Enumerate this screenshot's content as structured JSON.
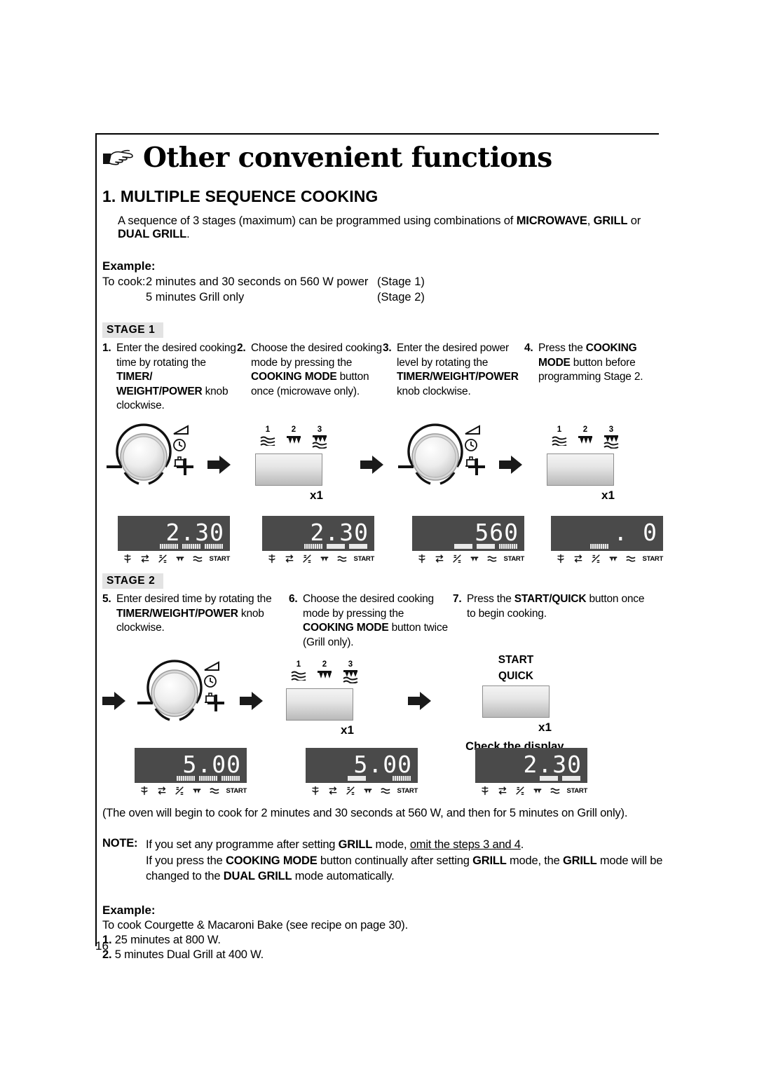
{
  "header": {
    "icon": "pointing-hand-icon",
    "title": "Other convenient functions"
  },
  "section": {
    "title": "1. MULTIPLE SEQUENCE COOKING",
    "intro_pre": "A sequence of 3 stages (maximum) can be programmed using combinations of ",
    "intro_b1": "MICROWAVE",
    "intro_mid1": ", ",
    "intro_b2": "GRILL",
    "intro_mid2": " or ",
    "intro_b3": "DUAL GRILL",
    "intro_end": "."
  },
  "example1": {
    "label": "Example:",
    "line1_c1": "To cook:",
    "line1_c2": "2 minutes and 30 seconds on 560 W power",
    "line1_c3": "(Stage 1)",
    "line2_c2": "5 minutes Grill only",
    "line2_c3": "(Stage 2)"
  },
  "stage1": {
    "band": "STAGE  1",
    "steps": [
      {
        "num": "1.",
        "pre": "Enter the desired cooking time by rotating the ",
        "b1": "TIMER/ WEIGHT/POWER",
        "post": " knob clockwise."
      },
      {
        "num": "2.",
        "pre": "Choose the desired cooking mode by pressing the ",
        "b1": "COOKING MODE",
        "post": " button once (microwave only)."
      },
      {
        "num": "3.",
        "pre": "Enter the desired power level by rotating the ",
        "b1": "TIMER/WEIGHT/POWER",
        "post": " knob clockwise."
      },
      {
        "num": "4.",
        "pre": "Press the ",
        "b1": "COOKING MODE",
        "post": " button before programming Stage 2."
      }
    ],
    "displays": [
      {
        "value": "2.30",
        "bars": [
          "hatch",
          "hatch",
          "hatch"
        ]
      },
      {
        "value": "2.30",
        "bars": [
          "hatch",
          "on",
          "on"
        ]
      },
      {
        "value": "560",
        "bars": [
          "on",
          "on",
          "hatch"
        ]
      },
      {
        "value": ".    0",
        "bars": [
          "hatch"
        ]
      }
    ],
    "press_count": "x1"
  },
  "stage2": {
    "band": "STAGE  2",
    "steps": [
      {
        "num": "5.",
        "pre": "Enter desired time by rotating the ",
        "b1": "TIMER/WEIGHT/POWER",
        "post": " knob clockwise."
      },
      {
        "num": "6.",
        "pre": "Choose the desired cooking mode by pressing the ",
        "b1": "COOKING MODE",
        "post": " button twice (Grill only)."
      },
      {
        "num": "7.",
        "pre": "Press the ",
        "b1": "START/QUICK",
        "post": " button once to begin cooking."
      }
    ],
    "displays": [
      {
        "value": "5.00",
        "bars": [
          "hatch",
          "hatch",
          "hatch"
        ]
      },
      {
        "value": "5.00",
        "bars": [
          "on",
          "off",
          "hatch"
        ]
      },
      {
        "value": "2.30",
        "bars": [
          "off",
          "on",
          "on"
        ]
      }
    ],
    "start_label_line1": "START",
    "start_label_line2": "QUICK",
    "check_display": "Check the display.",
    "press_count": "x1"
  },
  "mode_button_icons": [
    {
      "n": "1",
      "name": "microwave-waves-icon"
    },
    {
      "n": "2",
      "name": "grill-element-icon"
    },
    {
      "n": "3",
      "name": "dual-grill-icon"
    }
  ],
  "summary": "(The oven will begin to cook for 2 minutes and 30 seconds at 560 W, and then for 5 minutes on Grill only).",
  "note": {
    "label": "NOTE:",
    "l1_pre": "If you set any programme after setting ",
    "l1_b1": "GRILL",
    "l1_mid": " mode, ",
    "l1_u": "omit the steps 3 and 4",
    "l1_end": ".",
    "l2_pre": "If you press the ",
    "l2_b1": "COOKING MODE",
    "l2_mid1": " button continually after setting ",
    "l2_b2": "GRILL",
    "l2_mid2": " mode, the ",
    "l2_b3": "GRILL",
    "l2_end": " mode will be",
    "l3_pre": "changed to the ",
    "l3_b1": "DUAL GRILL",
    "l3_end": " mode automatically."
  },
  "example2": {
    "label": "Example:",
    "line0": "To cook Courgette & Macaroni Bake (see recipe on page 30).",
    "item1_num": "1.",
    "item1": "25 minutes at 800 W.",
    "item2_num": "2.",
    "item2": "5 minutes Dual Grill at 400 W."
  },
  "page_number": "16"
}
